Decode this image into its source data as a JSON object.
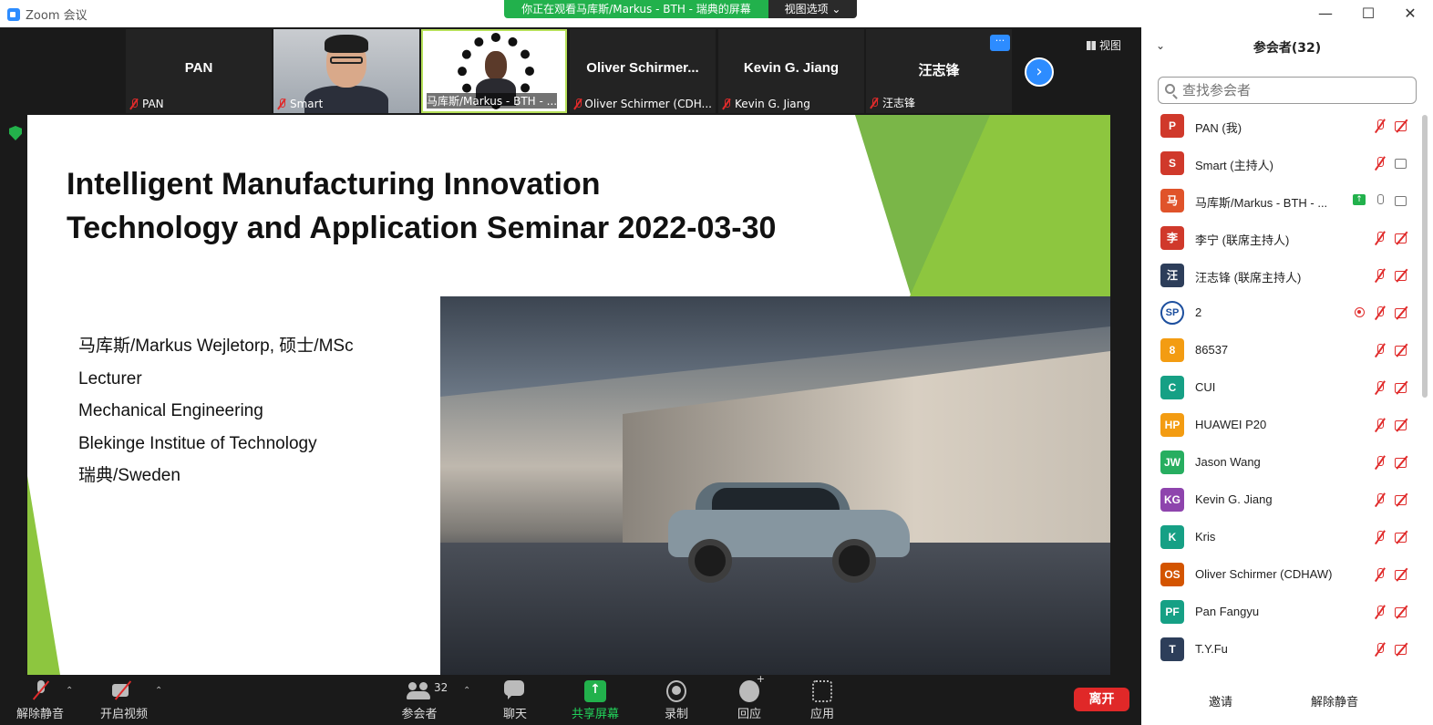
{
  "window": {
    "title": "Zoom 会议",
    "share_banner": "你正在观看马库斯/Markus - BTH - 瑞典的屏幕",
    "view_options": "视图选项 ⌄",
    "controls": {
      "minimize": "—",
      "maximize": "☐",
      "close": "✕"
    }
  },
  "strip": {
    "tiles": [
      {
        "name": "PAN",
        "label": "PAN"
      },
      {
        "name": "",
        "label": "Smart"
      },
      {
        "name": "",
        "label": "马库斯/Markus - BTH - ..."
      },
      {
        "name": "Oliver  Schirmer...",
        "label": "Oliver Schirmer (CDH..."
      },
      {
        "name": "Kevin G. Jiang",
        "label": "Kevin G. Jiang"
      },
      {
        "name": "汪志锋",
        "label": "汪志锋"
      }
    ],
    "more": "···",
    "next": "›",
    "view_label": "视图"
  },
  "slide": {
    "title_line1": "Intelligent Manufacturing Innovation",
    "title_line2": "Technology and Application Seminar  2022-03-30",
    "info": [
      "马库斯/Markus Wejletorp, 硕士/MSc",
      "Lecturer",
      "Mechanical Engineering",
      "Blekinge Institue of Technology",
      "瑞典/Sweden"
    ]
  },
  "toolbar": {
    "unmute": "解除静音",
    "start_video": "开启视频",
    "participants": "参会者",
    "participants_count": "32",
    "chat": "聊天",
    "share": "共享屏幕",
    "record": "录制",
    "reactions": "回应",
    "apps": "应用",
    "leave": "离开",
    "caret": "⌃"
  },
  "panel": {
    "title": "参会者(32)",
    "collapse": "⌄",
    "search_placeholder": "查找参会者",
    "participants": [
      {
        "initials": "P",
        "name": "PAN (我)",
        "color": "#d0392b",
        "mic": "off",
        "cam": "off"
      },
      {
        "initials": "S",
        "name": "Smart (主持人)",
        "color": "#d0392b",
        "mic": "off",
        "cam": "on"
      },
      {
        "initials": "马",
        "name": "马库斯/Markus - BTH - ...",
        "color": "#e0532a",
        "mic": "on",
        "cam": "on",
        "sharing": true
      },
      {
        "initials": "李",
        "name": "李宁 (联席主持人)",
        "color": "#d0392b",
        "mic": "off",
        "cam": "off"
      },
      {
        "initials": "汪",
        "name": "汪志锋 (联席主持人)",
        "color": "#2d3e5a",
        "mic": "off",
        "cam": "off"
      },
      {
        "initials": "SP",
        "name": "2",
        "color": "#1d4f9e",
        "mic": "off",
        "cam": "off",
        "recording": true,
        "logo": true
      },
      {
        "initials": "8",
        "name": "86537",
        "color": "#f39c12",
        "mic": "off",
        "cam": "off"
      },
      {
        "initials": "C",
        "name": "CUI",
        "color": "#16a085",
        "mic": "off",
        "cam": "off"
      },
      {
        "initials": "HP",
        "name": "HUAWEI P20",
        "color": "#f39c12",
        "mic": "off",
        "cam": "off"
      },
      {
        "initials": "JW",
        "name": "Jason Wang",
        "color": "#27ae60",
        "mic": "off",
        "cam": "off"
      },
      {
        "initials": "KG",
        "name": "Kevin G. Jiang",
        "color": "#8e44ad",
        "mic": "off",
        "cam": "off"
      },
      {
        "initials": "K",
        "name": "Kris",
        "color": "#16a085",
        "mic": "off",
        "cam": "off"
      },
      {
        "initials": "OS",
        "name": "Oliver Schirmer (CDHAW)",
        "color": "#d35400",
        "mic": "off",
        "cam": "off"
      },
      {
        "initials": "PF",
        "name": "Pan Fangyu",
        "color": "#16a085",
        "mic": "off",
        "cam": "off"
      },
      {
        "initials": "T",
        "name": "T.Y.Fu",
        "color": "#2d3e5a",
        "mic": "off",
        "cam": "off"
      }
    ],
    "invite": "邀请",
    "unmute_me": "解除静音"
  }
}
